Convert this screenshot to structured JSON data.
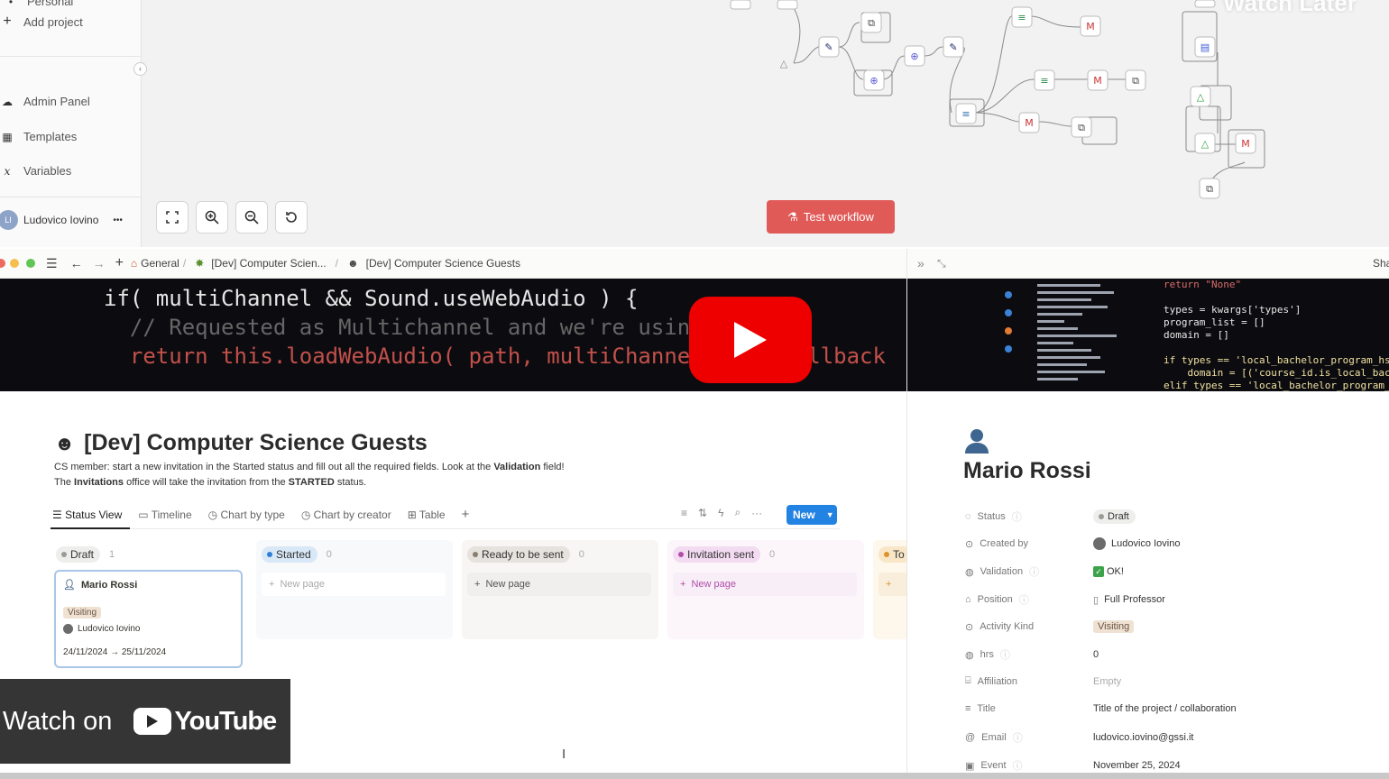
{
  "workflow": {
    "sidebar": {
      "cut_item": "Personal",
      "add_project": "Add project",
      "admin_panel": "Admin Panel",
      "templates": "Templates",
      "variables": "Variables",
      "user_initials": "LI",
      "user_name": "Ludovico Iovino",
      "more": "•••"
    },
    "test_button": "Test workflow",
    "watch_later": "Watch Later"
  },
  "window": {
    "breadcrumb": [
      "General",
      "[Dev] Computer Scien...",
      "[Dev] Computer Science Guests"
    ],
    "share": "Sha"
  },
  "video_code": {
    "left_lines": [
      "if( multiChannel && Sound.useWebAudio ) {",
      "  // Requested as Multichannel and we're using",
      "  return this.loadWebAudio( path, multiChannel, loadCallback"
    ],
    "right_lines": [
      "return \"None\"",
      "",
      "types = kwargs['types']",
      "program_list = []",
      "domain = []",
      "",
      "if types == 'local_bachelor_program_hsc':",
      "    domain = [('course_id.is_local_bachelor_",
      "elif types == 'local_bachelor_program_a_leve"
    ]
  },
  "database": {
    "title": "[Dev] Computer Science Guests",
    "desc_line1_a": "CS member: start a new invitation in the Started status and fill out all the required fields. Look at the ",
    "desc_line1_b": "Validation",
    "desc_line1_c": " field!",
    "desc_line2_a": "The ",
    "desc_line2_b": "Invitations",
    "desc_line2_c": " office will take the invitation from the ",
    "desc_line2_d": "STARTED",
    "desc_line2_e": " status.",
    "views": [
      "Status View",
      "Timeline",
      "Chart by type",
      "Chart by creator",
      "Table"
    ],
    "new_button": "New",
    "columns": [
      {
        "name": "Draft",
        "count": "1",
        "dot": "#9b9a97",
        "pill_bg": "#eeeeec"
      },
      {
        "name": "Started",
        "count": "0",
        "dot": "#2e7fd6",
        "pill_bg": "#d8e8f7"
      },
      {
        "name": "Ready to be sent",
        "count": "0",
        "dot": "#8a7e6e",
        "pill_bg": "#e6e2dd"
      },
      {
        "name": "Invitation sent",
        "count": "0",
        "dot": "#b04ea8",
        "pill_bg": "#f3dbf1"
      },
      {
        "name": "To",
        "count": "",
        "dot": "#d9952a",
        "pill_bg": "#f8e6c7"
      }
    ],
    "new_page": "New page",
    "card": {
      "title": "Mario Rossi",
      "tag": "Visiting",
      "owner": "Ludovico Iovino",
      "dates": "24/11/2024 → 25/11/2024"
    }
  },
  "record": {
    "name": "Mario Rossi",
    "props": [
      {
        "key": "Status",
        "value": "Draft"
      },
      {
        "key": "Created by",
        "value": "Ludovico Iovino"
      },
      {
        "key": "Validation",
        "value": "OK!"
      },
      {
        "key": "Position",
        "value": "Full Professor"
      },
      {
        "key": "Activity Kind",
        "value": "Visiting"
      },
      {
        "key": "hrs",
        "value": "0"
      },
      {
        "key": "Affiliation",
        "value": "Empty"
      },
      {
        "key": "Title",
        "value": "Title of the project / collaboration"
      },
      {
        "key": "Email",
        "value": "ludovico.iovino@gssi.it"
      },
      {
        "key": "Event",
        "value": "November 25, 2024"
      }
    ]
  },
  "youtube": {
    "watch_on": "Watch on",
    "logo_text": "YouTube"
  }
}
